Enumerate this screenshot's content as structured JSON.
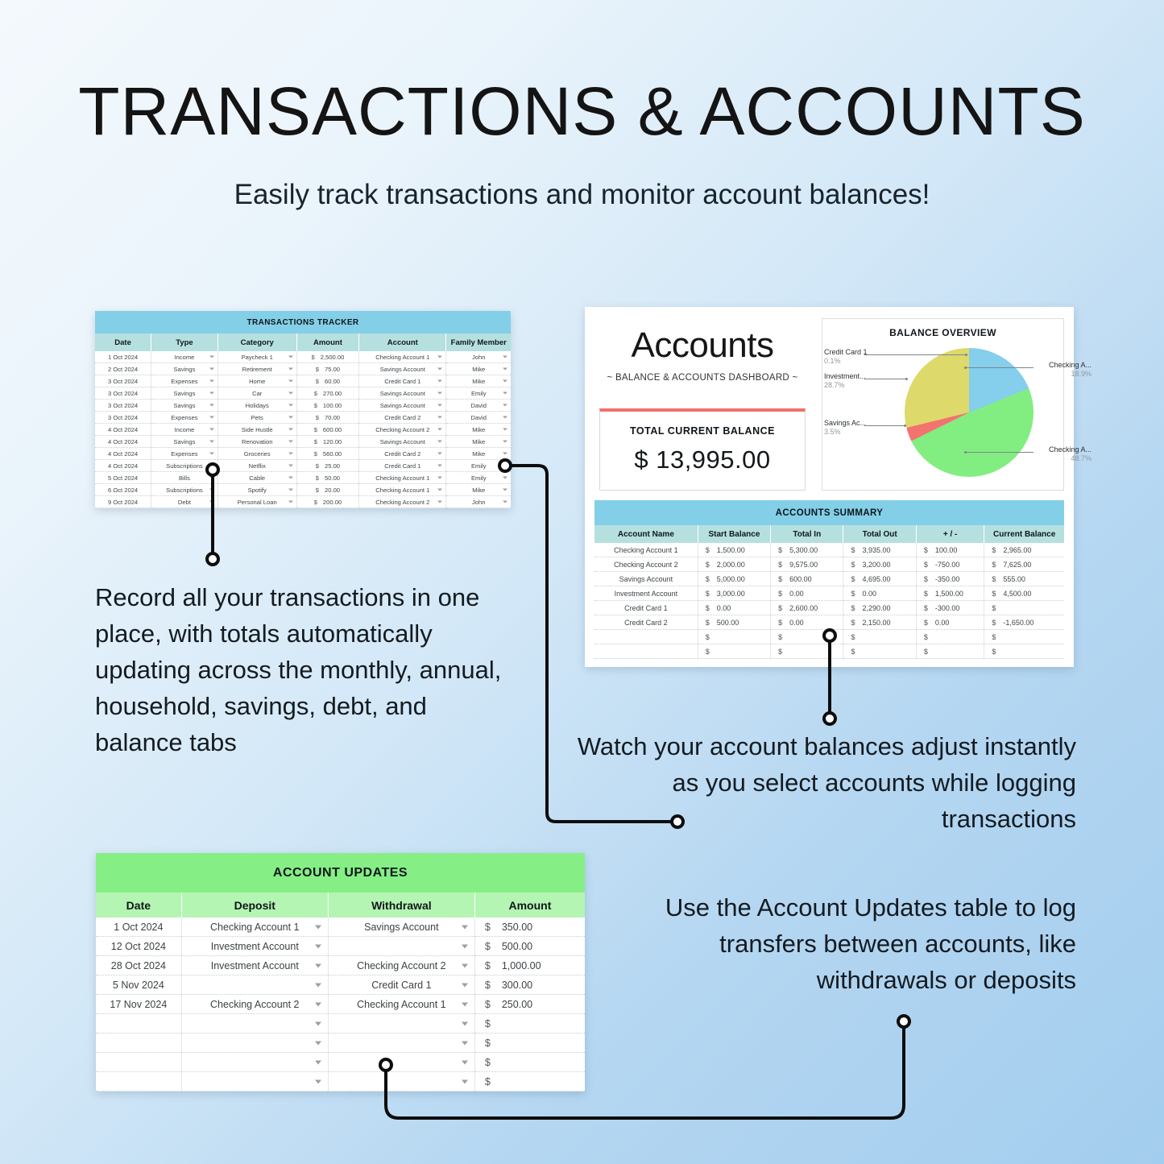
{
  "header": {
    "title": "TRANSACTIONS & ACCOUNTS",
    "subtitle": "Easily track transactions and monitor account balances!"
  },
  "colors": {
    "header_blue": "#83cfe8",
    "subheader_teal": "#b5e0df",
    "updates_green": "#85ef85",
    "updates_green_light": "#b4f5b4",
    "accent_red": "#f2706e",
    "pie_blue": "#85ceec",
    "pie_green": "#82ee82",
    "pie_red": "#f3736f",
    "pie_yellow": "#ddd96b"
  },
  "transactions": {
    "title": "TRANSACTIONS TRACKER",
    "columns": [
      "Date",
      "Type",
      "Category",
      "Amount",
      "Account",
      "Family Member"
    ],
    "currency_symbol": "$",
    "rows": [
      {
        "date": "1 Oct 2024",
        "type": "Income",
        "category": "Paycheck 1",
        "amount": "2,500.00",
        "account": "Checking Account 1",
        "member": "John"
      },
      {
        "date": "2 Oct 2024",
        "type": "Savings",
        "category": "Retirement",
        "amount": "75.00",
        "account": "Savings Account",
        "member": "Mike"
      },
      {
        "date": "3 Oct 2024",
        "type": "Expenses",
        "category": "Home",
        "amount": "60.00",
        "account": "Credit Card 1",
        "member": "Mike"
      },
      {
        "date": "3 Oct 2024",
        "type": "Savings",
        "category": "Car",
        "amount": "270.00",
        "account": "Savings Account",
        "member": "Emily"
      },
      {
        "date": "3 Oct 2024",
        "type": "Savings",
        "category": "Holidays",
        "amount": "100.00",
        "account": "Savings Account",
        "member": "David"
      },
      {
        "date": "3 Oct 2024",
        "type": "Expenses",
        "category": "Pets",
        "amount": "70.00",
        "account": "Credit Card 2",
        "member": "David"
      },
      {
        "date": "4 Oct 2024",
        "type": "Income",
        "category": "Side Hustle",
        "amount": "600.00",
        "account": "Checking Account 2",
        "member": "Mike"
      },
      {
        "date": "4 Oct 2024",
        "type": "Savings",
        "category": "Renovation",
        "amount": "120.00",
        "account": "Savings Account",
        "member": "Mike"
      },
      {
        "date": "4 Oct 2024",
        "type": "Expenses",
        "category": "Groceries",
        "amount": "560.00",
        "account": "Credit Card 2",
        "member": "Mike"
      },
      {
        "date": "4 Oct 2024",
        "type": "Subscriptions",
        "category": "Netflix",
        "amount": "25.00",
        "account": "Credit Card 1",
        "member": "Emily"
      },
      {
        "date": "5 Oct 2024",
        "type": "Bills",
        "category": "Cable",
        "amount": "50.00",
        "account": "Checking Account 1",
        "member": "Emily"
      },
      {
        "date": "6 Oct 2024",
        "type": "Subscriptions",
        "category": "Spotify",
        "amount": "20.00",
        "account": "Checking Account 1",
        "member": "Mike"
      },
      {
        "date": "9 Oct 2024",
        "type": "Debt",
        "category": "Personal Loan",
        "amount": "200.00",
        "account": "Checking Account 2",
        "member": "John"
      }
    ]
  },
  "accounts": {
    "heading": "Accounts",
    "subheading": "~ BALANCE & ACCOUNTS DASHBOARD ~",
    "total_balance_label": "TOTAL CURRENT BALANCE",
    "total_balance_value": "$ 13,995.00",
    "summary": {
      "title": "ACCOUNTS SUMMARY",
      "columns": [
        "Account Name",
        "Start Balance",
        "Total In",
        "Total Out",
        "+ / -",
        "Current Balance"
      ],
      "currency_symbol": "$",
      "rows": [
        {
          "name": "Checking Account 1",
          "start": "1,500.00",
          "in": "5,300.00",
          "out": "3,935.00",
          "plusminus": "100.00",
          "current": "2,965.00"
        },
        {
          "name": "Checking Account 2",
          "start": "2,000.00",
          "in": "9,575.00",
          "out": "3,200.00",
          "plusminus": "-750.00",
          "current": "7,625.00"
        },
        {
          "name": "Savings Account",
          "start": "5,000.00",
          "in": "600.00",
          "out": "4,695.00",
          "plusminus": "-350.00",
          "current": "555.00"
        },
        {
          "name": "Investment Account",
          "start": "3,000.00",
          "in": "0.00",
          "out": "0.00",
          "plusminus": "1,500.00",
          "current": "4,500.00"
        },
        {
          "name": "Credit Card 1",
          "start": "0.00",
          "in": "2,600.00",
          "out": "2,290.00",
          "plusminus": "-300.00",
          "current": ""
        },
        {
          "name": "Credit Card 2",
          "start": "500.00",
          "in": "0.00",
          "out": "2,150.00",
          "plusminus": "0.00",
          "current": "-1,650.00"
        },
        {
          "name": "",
          "start": "",
          "in": "",
          "out": "",
          "plusminus": "",
          "current": ""
        },
        {
          "name": "",
          "start": "",
          "in": "",
          "out": "",
          "plusminus": "",
          "current": ""
        }
      ]
    }
  },
  "chart_data": {
    "type": "pie",
    "title": "BALANCE OVERVIEW",
    "labels": [
      "Checking A...",
      "Checking A...",
      "Savings Ac...",
      "Investment...",
      "Credit Card 1"
    ],
    "values": [
      18.9,
      48.7,
      3.5,
      28.7,
      0.1
    ],
    "percent_labels": [
      "18.9%",
      "48.7%",
      "3.5%",
      "28.7%",
      "0.1%"
    ],
    "colors": [
      "#85ceec",
      "#82ee82",
      "#f3736f",
      "#ddd96b",
      "#ddd96b"
    ],
    "legend_position": "callout-labels",
    "start_angle_deg": 0,
    "direction": "clockwise"
  },
  "updates": {
    "title": "ACCOUNT UPDATES",
    "columns": [
      "Date",
      "Deposit",
      "Withdrawal",
      "Amount"
    ],
    "currency_symbol": "$",
    "rows": [
      {
        "date": "1 Oct 2024",
        "deposit": "Checking Account 1",
        "withdrawal": "Savings Account",
        "amount": "350.00"
      },
      {
        "date": "12 Oct 2024",
        "deposit": "Investment Account",
        "withdrawal": "",
        "amount": "500.00"
      },
      {
        "date": "28 Oct 2024",
        "deposit": "Investment Account",
        "withdrawal": "Checking Account 2",
        "amount": "1,000.00"
      },
      {
        "date": "5 Nov 2024",
        "deposit": "",
        "withdrawal": "Credit Card 1",
        "amount": "300.00"
      },
      {
        "date": "17 Nov 2024",
        "deposit": "Checking Account 2",
        "withdrawal": "Checking Account 1",
        "amount": "250.00"
      },
      {
        "date": "",
        "deposit": "",
        "withdrawal": "",
        "amount": ""
      },
      {
        "date": "",
        "deposit": "",
        "withdrawal": "",
        "amount": ""
      },
      {
        "date": "",
        "deposit": "",
        "withdrawal": "",
        "amount": ""
      },
      {
        "date": "",
        "deposit": "",
        "withdrawal": "",
        "amount": ""
      }
    ]
  },
  "copy": {
    "transactions": "Record all your transactions in one place, with totals automatically updating across the monthly, annual, household, savings, debt, and balance tabs",
    "accounts": "Watch your account balances adjust instantly as you select accounts while logging transactions",
    "updates": "Use the Account Updates table to log transfers between accounts, like withdrawals or deposits"
  }
}
